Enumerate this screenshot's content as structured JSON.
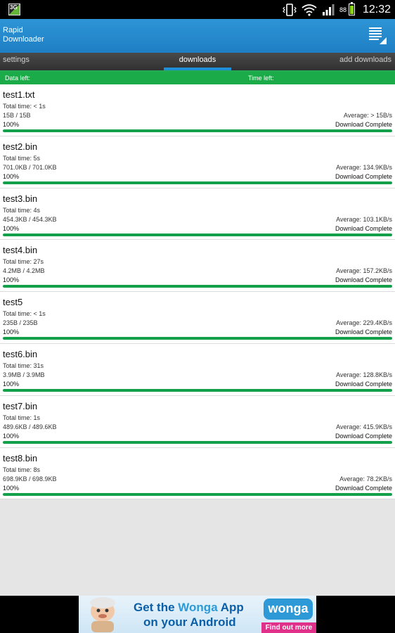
{
  "status_bar": {
    "network_badge": "3G",
    "battery_level": "88",
    "time": "12:32",
    "icons": [
      "network-3g-icon",
      "vibrate-icon",
      "wifi-icon",
      "signal-icon",
      "battery-icon"
    ]
  },
  "app": {
    "title": "Rapid\nDownloader",
    "accent_color": "#1f8fd8",
    "progress_color": "#12a04a"
  },
  "tabs": [
    {
      "label": "settings"
    },
    {
      "label": "downloads",
      "selected": true
    },
    {
      "label": "add downloads"
    }
  ],
  "summary": {
    "data_left_label": "Data left:",
    "time_left_label": "Time left:"
  },
  "downloads": [
    {
      "name": "test1.txt",
      "total_time": "Total time: < 1s",
      "size": "15B / 15B",
      "average": "Average: > 15B/s",
      "percent": "100%",
      "status": "Download Complete",
      "progress": 1.0
    },
    {
      "name": "test2.bin",
      "total_time": "Total time: 5s",
      "size": "701.0KB / 701.0KB",
      "average": "Average: 134.9KB/s",
      "percent": "100%",
      "status": "Download Complete",
      "progress": 1.0
    },
    {
      "name": "test3.bin",
      "total_time": "Total time: 4s",
      "size": "454.3KB / 454.3KB",
      "average": "Average: 103.1KB/s",
      "percent": "100%",
      "status": "Download Complete",
      "progress": 1.0
    },
    {
      "name": "test4.bin",
      "total_time": "Total time: 27s",
      "size": "4.2MB / 4.2MB",
      "average": "Average: 157.2KB/s",
      "percent": "100%",
      "status": "Download Complete",
      "progress": 1.0
    },
    {
      "name": "test5",
      "total_time": "Total time: < 1s",
      "size": "235B / 235B",
      "average": "Average: 229.4KB/s",
      "percent": "100%",
      "status": "Download Complete",
      "progress": 1.0
    },
    {
      "name": "test6.bin",
      "total_time": "Total time: 31s",
      "size": "3.9MB / 3.9MB",
      "average": "Average: 128.8KB/s",
      "percent": "100%",
      "status": "Download Complete",
      "progress": 1.0
    },
    {
      "name": "test7.bin",
      "total_time": "Total time: 1s",
      "size": "489.6KB / 489.6KB",
      "average": "Average: 415.9KB/s",
      "percent": "100%",
      "status": "Download Complete",
      "progress": 1.0
    },
    {
      "name": "test8.bin",
      "total_time": "Total time: 8s",
      "size": "698.9KB / 698.9KB",
      "average": "Average: 78.2KB/s",
      "percent": "100%",
      "status": "Download Complete",
      "progress": 1.0
    }
  ],
  "ad": {
    "line1_prefix": "Get the ",
    "line1_brand": "Wonga",
    "line1_suffix": " App",
    "line2": "on your Android",
    "brand_logo": "wonga",
    "cta": "Find out more"
  }
}
